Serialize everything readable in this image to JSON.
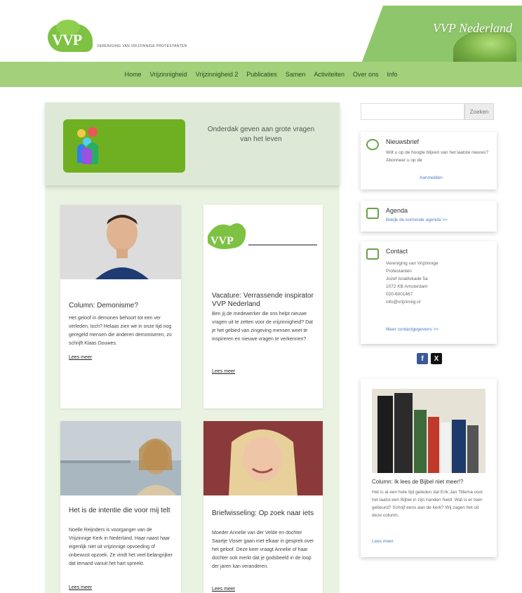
{
  "header": {
    "logo_text": "VVP",
    "logo_tagline": "VERENIGING VAN VRIJZINNIGE PROTESTANTEN",
    "brand": "VVP Nederland"
  },
  "nav": {
    "items": [
      "Home",
      "Vrijzinnigheid",
      "Vrijzinnigheid 2",
      "Publicaties",
      "Samen",
      "Activiteiten",
      "Over ons",
      "Info"
    ]
  },
  "hero": {
    "quote": "Onderdak geven aan grote vragen van het leven"
  },
  "cards": [
    {
      "title": "Column: Demonisme?",
      "body": "Het geloof in demonen behoort tot een ver verleden, toch? Helaas zien we in onze tijd nog geregeld mensen die anderen demoniseren, zo schrijft Klaas Douwes.",
      "more": "Lees meer"
    },
    {
      "title": "Vacature: Verrassende inspirator VVP Nederland",
      "body": "Ben jij de medewerker die ons helpt nieuwe vragen uit te zetten voor de vrijzinnigheid? Dat je het gebied van zingeving mensen weet te inspireren en nieuwe vragen te verkennen?",
      "more": "Lees meer"
    },
    {
      "title": "Het is de intentie die voor mij telt",
      "body": "Noelle Reijnders is voorganger van de Vrijzinnige Kerk in Nederland. Haar naast haar eigenlijk niet uit vrijzinnige opvoeding of onbewust opzoek. Ze vindt het veel belangrijker dat iemand vanuit het hart spreekt.",
      "more": "Lees meer"
    },
    {
      "title": "Briefwisseling: Op zoek naar iets",
      "body": "Moeder Annelie van der Velde en dochter Saartje Visser gaan met elkaar in gesprek over het geloof. Deze keer vraagt Annelie of haar dochter ook merkt dat je godsbeeld in de loop der jaren kan veranderen.",
      "more": "Lees meer"
    }
  ],
  "sidebar": {
    "search_placeholder": "",
    "search_button": "Zoeken",
    "newsletter": {
      "title": "Nieuwsbrief",
      "text": "Wilt u op de hoogte blijven van het laatste nieuws? Abonneer u op de",
      "link": "Aanmelden"
    },
    "agenda": {
      "title": "Agenda",
      "link": "Bekijk de komende agenda >>"
    },
    "contact": {
      "title": "Contact",
      "lines": [
        "Vereniging van Vrijzinnige",
        "Protestanten",
        "Jozef Israëlskade 5a",
        "1072 KB Amsterdam",
        "020-6001467",
        "info@vrijzinnig.nl"
      ],
      "link": "Meer contactgegevens >>"
    },
    "social": [
      "f",
      "X"
    ],
    "feature": {
      "title": "Column: Ik lees de Bijbel niet meer!?",
      "body": "Het is al een hele tijd geleden dat Erik Jan Tillema voor het laatst een Bijbel in zijn handen hield. Wat is er toen gebeurd? Schrijf eens aan de kerk? Wij zagen het uit deze column.",
      "link": "Lees meer"
    }
  },
  "colors": {
    "nav_bg": "#a3d07b",
    "brand_green": "#7dc242",
    "main_bg": "#eaf3e2",
    "hero_bg": "#dde9d6",
    "link": "#4a7fc0"
  }
}
